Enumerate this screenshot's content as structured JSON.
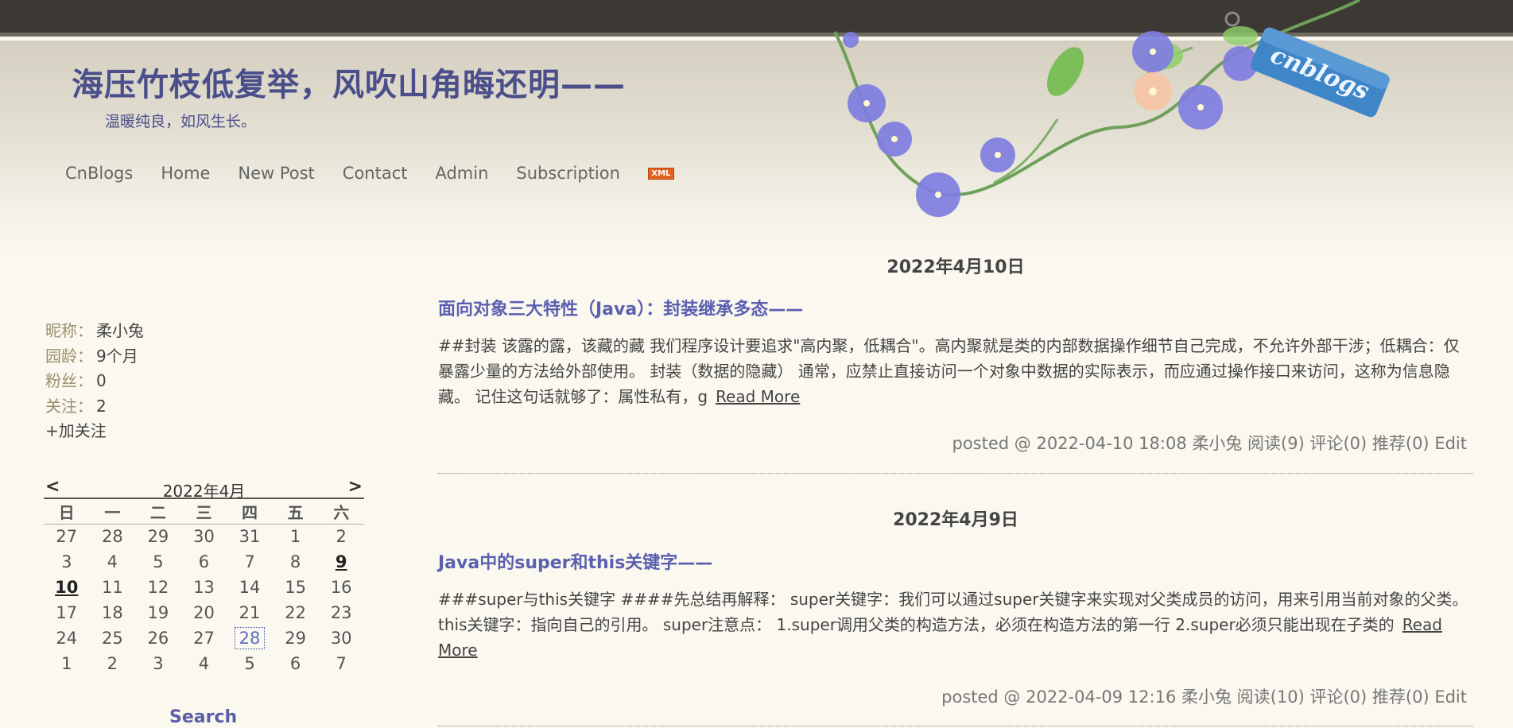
{
  "blog": {
    "title": "海压竹枝低复举，风吹山角晦还明——",
    "subtitle": "温暖纯良，如风生长。",
    "tag_text": "cnblogs"
  },
  "nav": {
    "items": [
      "CnBlogs",
      "Home",
      "New Post",
      "Contact",
      "Admin",
      "Subscription"
    ],
    "xml_label": "XML"
  },
  "profile": {
    "nickname_label": "昵称：",
    "nickname": "柔小兔",
    "age_label": "园龄：",
    "age": "9个月",
    "fans_label": "粉丝：",
    "fans": "0",
    "following_label": "关注：",
    "following": "2",
    "follow_button": "+加关注"
  },
  "calendar": {
    "prev": "<",
    "next": ">",
    "title": "2022年4月",
    "weekdays": [
      "日",
      "一",
      "二",
      "三",
      "四",
      "五",
      "六"
    ],
    "weeks": [
      [
        "27",
        "28",
        "29",
        "30",
        "31",
        "1",
        "2"
      ],
      [
        "3",
        "4",
        "5",
        "6",
        "7",
        "8",
        "9"
      ],
      [
        "10",
        "11",
        "12",
        "13",
        "14",
        "15",
        "16"
      ],
      [
        "17",
        "18",
        "19",
        "20",
        "21",
        "22",
        "23"
      ],
      [
        "24",
        "25",
        "26",
        "27",
        "28",
        "29",
        "30"
      ],
      [
        "1",
        "2",
        "3",
        "4",
        "5",
        "6",
        "7"
      ]
    ],
    "post_days": [
      "9",
      "10"
    ],
    "today": "28"
  },
  "search": {
    "title": "Search"
  },
  "posts": [
    {
      "date": "2022年4月10日",
      "title": "面向对象三大特性（Java）：封装继承多态——",
      "summary": "##封装 该露的露，该藏的藏 我们程序设计要追求\"高内聚，低耦合\"。高内聚就是类的内部数据操作细节自己完成，不允许外部干涉；低耦合：仅暴露少量的方法给外部使用。 封装（数据的隐藏） 通常，应禁止直接访问一个对象中数据的实际表示，而应通过操作接口来访问，这称为信息隐藏。 记住这句话就够了：属性私有，g",
      "read_more": "Read More",
      "footer": "posted @ 2022-04-10 18:08 柔小兔 阅读(9) 评论(0) 推荐(0)",
      "edit": "Edit"
    },
    {
      "date": "2022年4月9日",
      "title": "Java中的super和this关键字——",
      "summary": "###super与this关键字 ####先总结再解释： super关键字：我们可以通过super关键字来实现对父类成员的访问，用来引用当前对象的父类。 this关键字：指向自己的引用。 super注意点： 1.super调用父类的构造方法，必须在构造方法的第一行 2.super必须只能出现在子类的",
      "read_more": "Read More",
      "footer": "posted @ 2022-04-09 12:16 柔小兔 阅读(10) 评论(0) 推荐(0)",
      "edit": "Edit"
    }
  ]
}
